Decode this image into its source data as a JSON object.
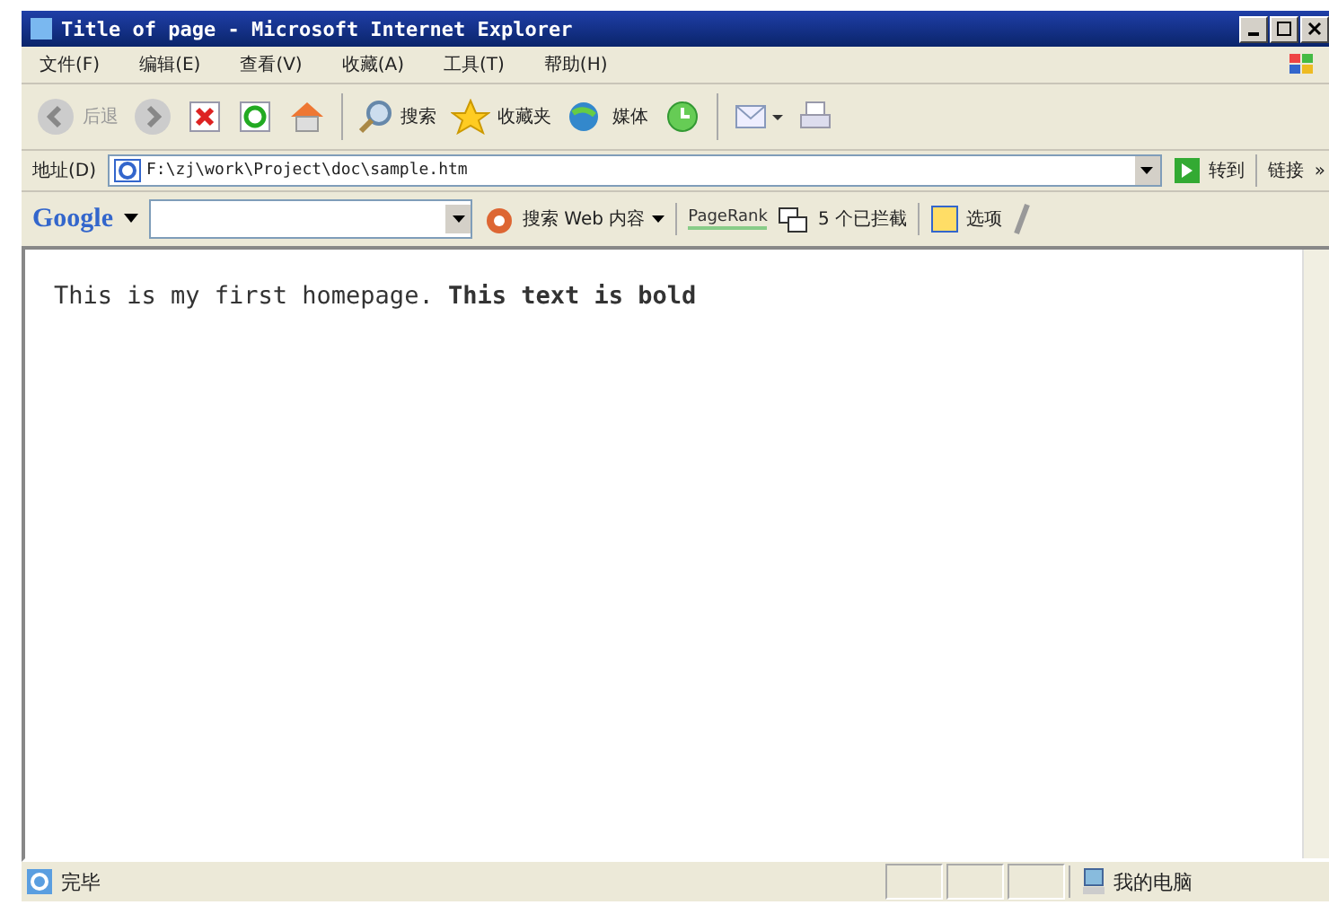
{
  "window": {
    "title": "Title of page - Microsoft Internet Explorer"
  },
  "menu": [
    "文件(F)",
    "编辑(E)",
    "查看(V)",
    "收藏(A)",
    "工具(T)",
    "帮助(H)"
  ],
  "toolbar": {
    "back": "后退",
    "search": "搜索",
    "favorites": "收藏夹",
    "media": "媒体"
  },
  "address_bar": {
    "label": "地址(D)",
    "value": "F:\\zj\\work\\Project\\doc\\sample.htm",
    "go": "转到",
    "links": "链接",
    "more": "»"
  },
  "google_bar": {
    "logo": "Google",
    "search": "搜索 Web 内容",
    "pagerank": "PageRank",
    "blocked": "5 个已拦截",
    "options": "选项"
  },
  "content": {
    "paragraph": "This is my first homepage. **This text is bold**"
  },
  "status_bar": {
    "status": "完毕",
    "zone": "我的电脑"
  }
}
